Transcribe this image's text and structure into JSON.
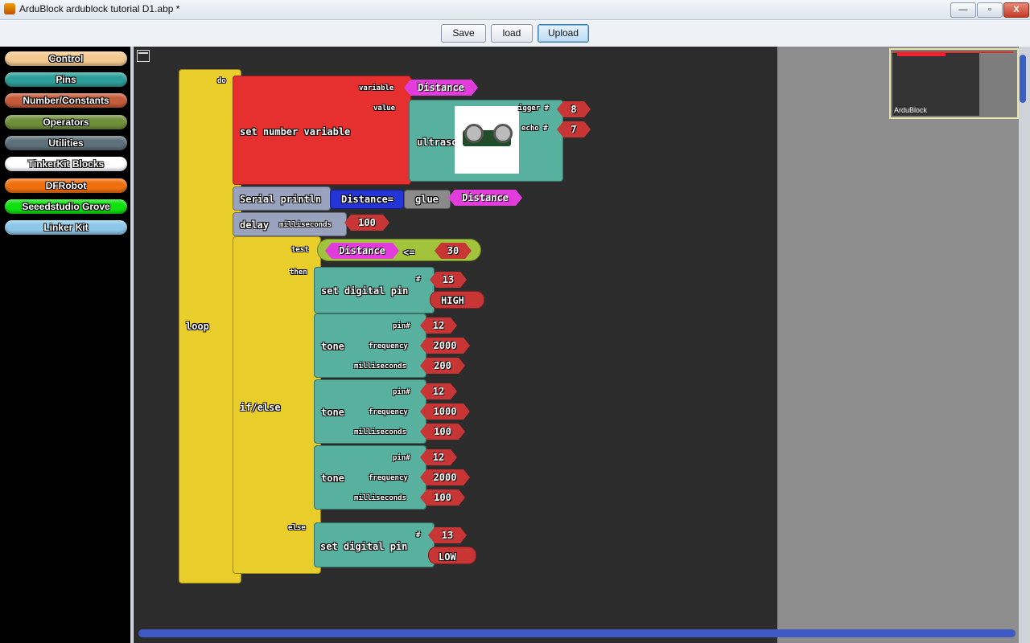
{
  "window": {
    "title": "ArduBlock ardublock tutorial D1.abp *",
    "min": "—",
    "max": "▫",
    "close": "X"
  },
  "toolbar": {
    "save": "Save",
    "load": "load",
    "upload": "Upload"
  },
  "palette": [
    "Control",
    "Pins",
    "Number/Constants",
    "Operators",
    "Utilities",
    "TinkerKit Blocks",
    "DFRobot",
    "Seeedstudio Grove",
    "Linker Kit"
  ],
  "palette_colors": [
    "#f4c990",
    "#2f9e9a",
    "#c45b3a",
    "#6f8f3a",
    "#5d6f78",
    "#ffffff",
    "#f07010",
    "#10e010",
    "#8ec8e8"
  ],
  "minimap": {
    "label": "ArduBlock"
  },
  "blocks": {
    "loop": "loop",
    "do": "do",
    "set_var": "set number variable",
    "variable": "variable",
    "value": "value",
    "var_name": "Distance",
    "ultrasonic": "ultrasonic",
    "trigger": "igger #",
    "echo": "echo #",
    "trigger_val": "8",
    "echo_val": "7",
    "serial": "Serial println",
    "serial_str": "Distance=",
    "glue": "glue",
    "glue_var": "Distance",
    "delay": "delay",
    "ms_label": "milliseconds",
    "delay_val": "100",
    "ifelse": "if/else",
    "test": "test",
    "then": "then",
    "else": "else",
    "cond_var": "Distance",
    "cond_op": "<=",
    "cond_val": "30",
    "set_pin": "set digital pin",
    "hash": "#",
    "pin1": "13",
    "high": "HIGH",
    "pin2": "13",
    "low": "LOW",
    "tone": "tone",
    "pin_lbl": "pin#",
    "freq_lbl": "frequency",
    "t1": {
      "pin": "12",
      "freq": "2000",
      "ms": "200"
    },
    "t2": {
      "pin": "12",
      "freq": "1000",
      "ms": "100"
    },
    "t3": {
      "pin": "12",
      "freq": "2000",
      "ms": "100"
    }
  }
}
